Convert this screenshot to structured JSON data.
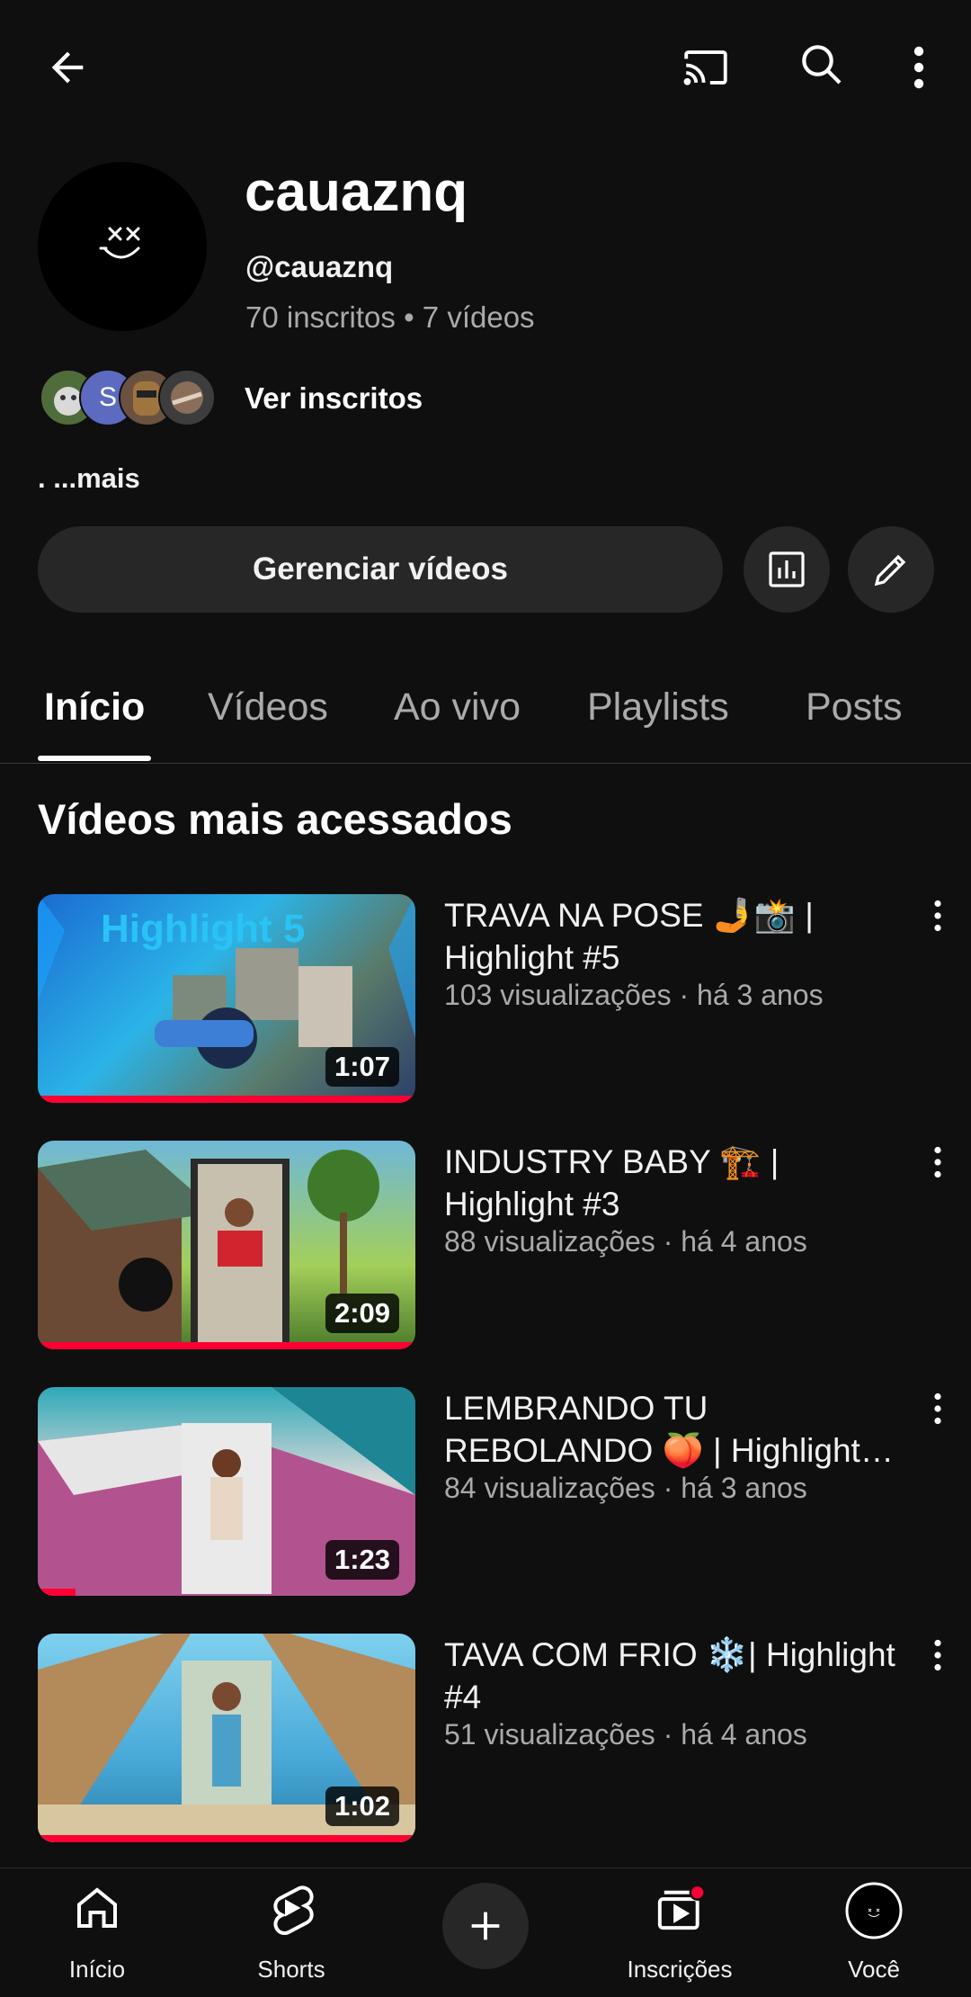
{
  "colors": {
    "background": "#0f0f0f",
    "accent": "#ff0033",
    "muted": "#aaaaaa",
    "button_bg": "#272727"
  },
  "topbar": {
    "icons": [
      "back-arrow-icon",
      "cast-icon",
      "search-icon",
      "more-vert-icon"
    ]
  },
  "channel": {
    "name": "cauaznq",
    "handle": "@cauaznq",
    "stats": "70 inscritos • 7 vídeos",
    "subscribers_link": "Ver inscritos",
    "subscriber_avatar_letter": "S",
    "description": ". ...mais"
  },
  "actions": {
    "manage_label": "Gerenciar vídeos",
    "analytics_icon": "analytics-icon",
    "edit_icon": "pencil-icon"
  },
  "tabs": [
    {
      "label": "Início"
    },
    {
      "label": "Vídeos"
    },
    {
      "label": "Ao vivo"
    },
    {
      "label": "Playlists"
    },
    {
      "label": "Posts"
    }
  ],
  "section": {
    "title": "Vídeos mais acessados"
  },
  "videos": [
    {
      "title": "TRAVA NA POSE 🤳📸 | Highlight #5",
      "meta": "103 visualizações · há 3 anos",
      "duration": "1:07",
      "thumb_text": "Highlight 5",
      "progress": 1.0
    },
    {
      "title": "INDUSTRY BABY 🏗️ | Highlight #3",
      "meta": "88 visualizações · há 4 anos",
      "duration": "2:09",
      "progress": 1.0
    },
    {
      "title": "LEMBRANDO TU REBOLANDO 🍑 | Highlight…",
      "meta": "84 visualizações · há 3 anos",
      "duration": "1:23",
      "progress": 0.1
    },
    {
      "title": "TAVA COM FRIO ❄️| Highlight #4",
      "meta": "51 visualizações · há 4 anos",
      "duration": "1:02",
      "progress": 1.0
    }
  ],
  "bottom_nav": [
    {
      "label": "Início",
      "icon": "home-icon"
    },
    {
      "label": "Shorts",
      "icon": "shorts-icon"
    },
    {
      "label": "",
      "icon": "create-plus-icon"
    },
    {
      "label": "Inscrições",
      "icon": "subscriptions-icon"
    },
    {
      "label": "Você",
      "icon": "profile-avatar-icon"
    }
  ]
}
